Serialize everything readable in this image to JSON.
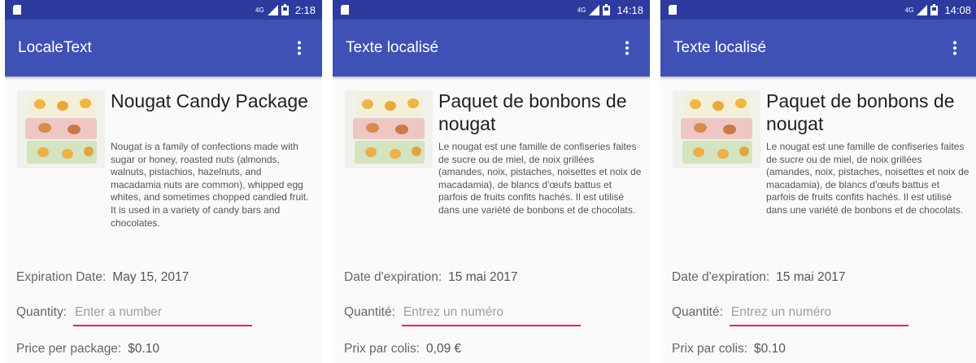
{
  "colors": {
    "status_bar": "#2d3a9e",
    "app_bar": "#3f51b5",
    "accent": "#e91e63",
    "background": "#fafafa"
  },
  "phones": [
    {
      "status": {
        "network": "4G",
        "time": "2:18"
      },
      "app_title": "LocaleText",
      "product": {
        "title": "Nougat Candy Package",
        "description": "Nougat is a family of confections made with sugar or honey, roasted nuts (almonds, walnuts, pistachios, hazelnuts, and macadamia nuts are common), whipped egg whites, and sometimes chopped candied fruit. It is used in a variety of candy bars and chocolates."
      },
      "expiration": {
        "label": "Expiration Date:",
        "value": "May 15, 2017"
      },
      "quantity": {
        "label": "Quantity:",
        "placeholder": "Enter a number",
        "value": ""
      },
      "price": {
        "label": "Price per package:",
        "value": "$0.10"
      }
    },
    {
      "status": {
        "network": "4G",
        "time": "14:18"
      },
      "app_title": "Texte localisé",
      "product": {
        "title": "Paquet de bonbons de nougat",
        "description": "Le nougat est une famille de confiseries faites de sucre ou de miel, de noix grillées (amandes, noix, pistaches, noisettes et noix de macadamia), de blancs d'œufs battus et parfois de fruits confits hachés. Il est utilisé dans une variété de bonbons et de chocolats."
      },
      "expiration": {
        "label": "Date d'expiration:",
        "value": "15 mai 2017"
      },
      "quantity": {
        "label": "Quantité:",
        "placeholder": "Entrez un numéro",
        "value": ""
      },
      "price": {
        "label": "Prix par colis:",
        "value": "0,09 €"
      }
    },
    {
      "status": {
        "network": "4G",
        "time": "14:08"
      },
      "app_title": "Texte localisé",
      "product": {
        "title": "Paquet de bonbons de nougat",
        "description": "Le nougat est une famille de confiseries faites de sucre ou de miel, de noix grillées (amandes, noix, pistaches, noisettes et noix de macadamia), de blancs d'œufs battus et parfois de fruits confits hachés. Il est utilisé dans une variété de bonbons et de chocolats."
      },
      "expiration": {
        "label": "Date d'expiration:",
        "value": "15 mai 2017"
      },
      "quantity": {
        "label": "Quantité:",
        "placeholder": "Entrez un numéro",
        "value": ""
      },
      "price": {
        "label": "Prix par colis:",
        "value": "$0.10"
      }
    }
  ]
}
